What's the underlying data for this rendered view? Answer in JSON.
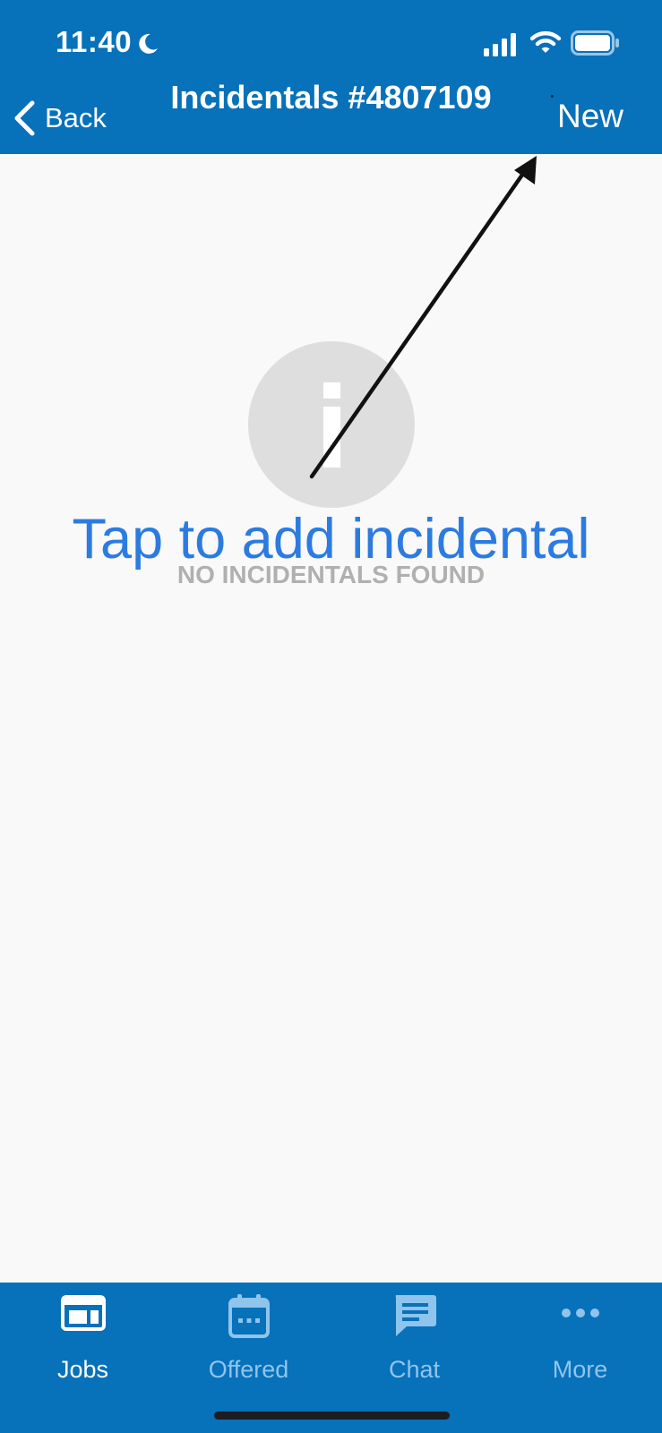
{
  "status_bar": {
    "time": "11:40"
  },
  "header": {
    "back_label": "Back",
    "title": "Incidentals #4807109",
    "new_label": "New"
  },
  "empty_state": {
    "title": "Tap to add incidental",
    "subtitle": "NO INCIDENTALS FOUND",
    "icon": "info-icon"
  },
  "tab_bar": {
    "tabs": [
      {
        "label": "Jobs",
        "icon": "jobs-icon",
        "active": true
      },
      {
        "label": "Offered",
        "icon": "calendar-icon",
        "active": false
      },
      {
        "label": "Chat",
        "icon": "chat-icon",
        "active": false
      },
      {
        "label": "More",
        "icon": "more-icon",
        "active": false
      }
    ]
  },
  "colors": {
    "brand": "#0771BA",
    "accent_text": "#2c7be0",
    "muted_text": "#b0b0b0",
    "inactive_tab": "#8fc4ec"
  }
}
